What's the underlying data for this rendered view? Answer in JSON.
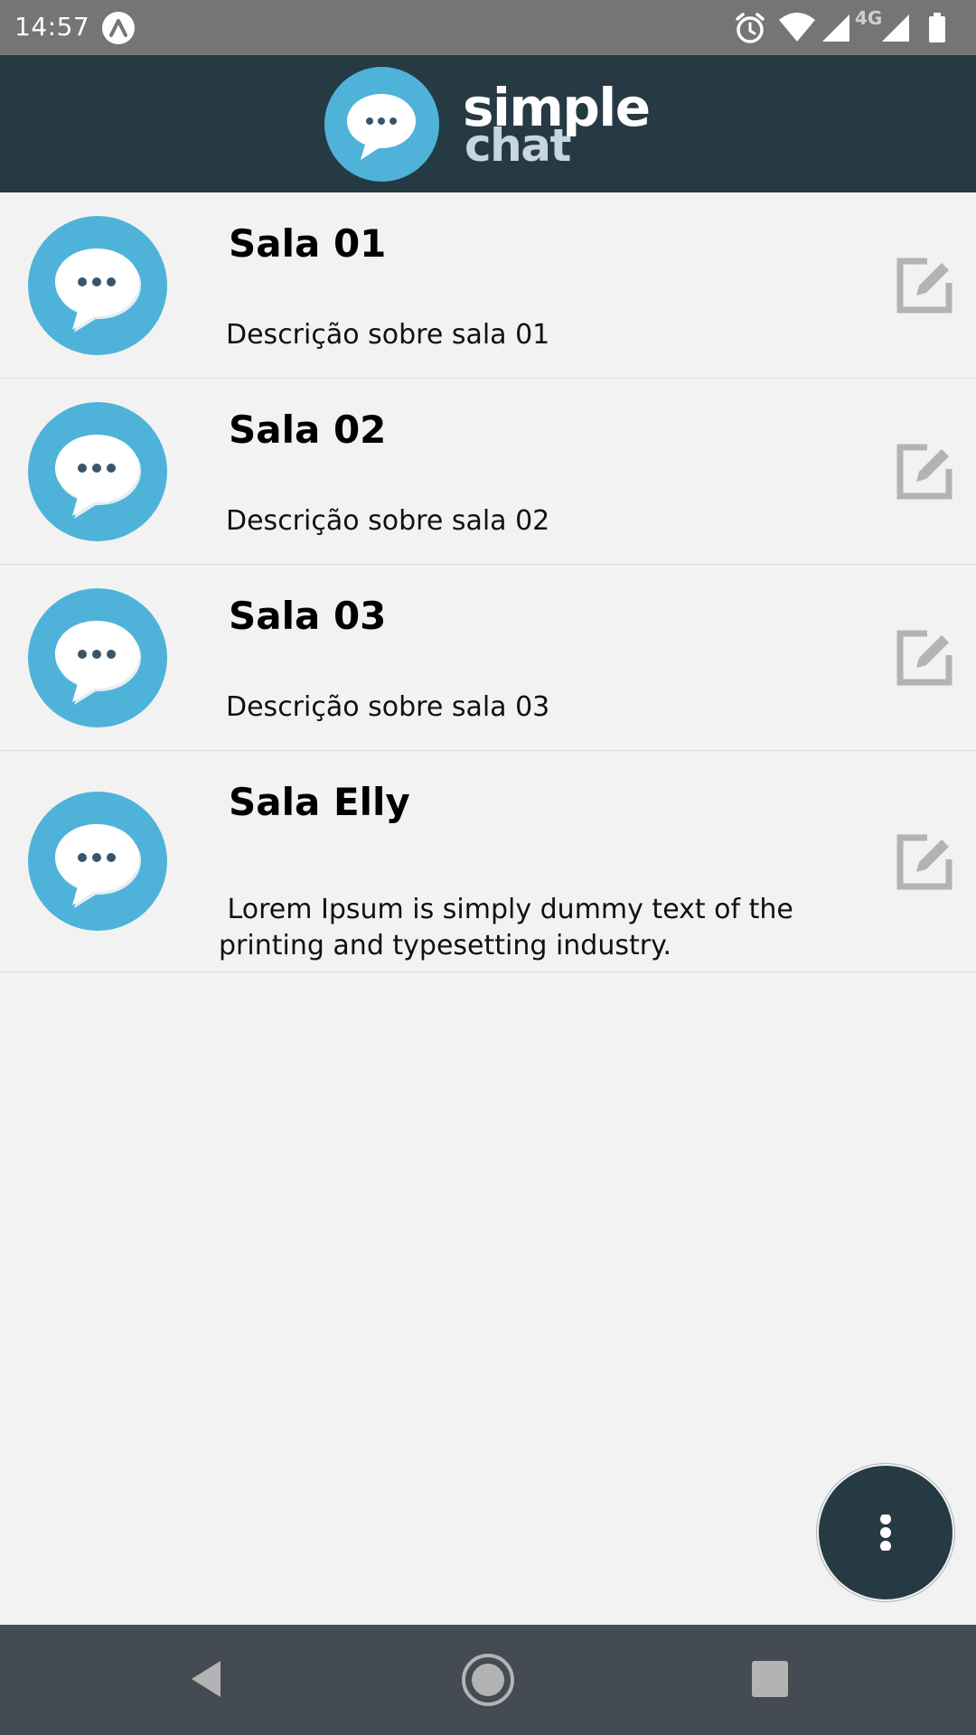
{
  "status_bar": {
    "time": "14:57",
    "network_label": "4G",
    "icons": [
      "app-notification-icon",
      "alarm-icon",
      "wifi-icon",
      "cell-signal-icon",
      "battery-icon"
    ]
  },
  "app_bar": {
    "logo_line1": "simple",
    "logo_line2": "chat",
    "colors": {
      "background": "#263a44",
      "logo_circle": "#4fb3d9",
      "logo_text_primary": "#ffffff",
      "logo_text_secondary": "#c7d6e0"
    }
  },
  "rooms": [
    {
      "title": "Sala 01",
      "description": "Descrição sobre sala 01"
    },
    {
      "title": "Sala 02",
      "description": "Descrição sobre sala 02"
    },
    {
      "title": "Sala 03",
      "description": "Descrição sobre sala 03"
    },
    {
      "title": "Sala Elly",
      "description": " Lorem Ipsum is simply dummy text of the printing and typesetting industry."
    }
  ],
  "fab": {
    "icon": "more-vertical-icon"
  },
  "nav_bar": {
    "icons": [
      "back-icon",
      "home-icon",
      "recents-icon"
    ]
  },
  "colors": {
    "page_background": "#f2f2f2",
    "avatar_circle": "#4fb3d9",
    "edit_icon": "#b3b3b3",
    "nav_background": "#454b52",
    "status_background": "#757575"
  }
}
